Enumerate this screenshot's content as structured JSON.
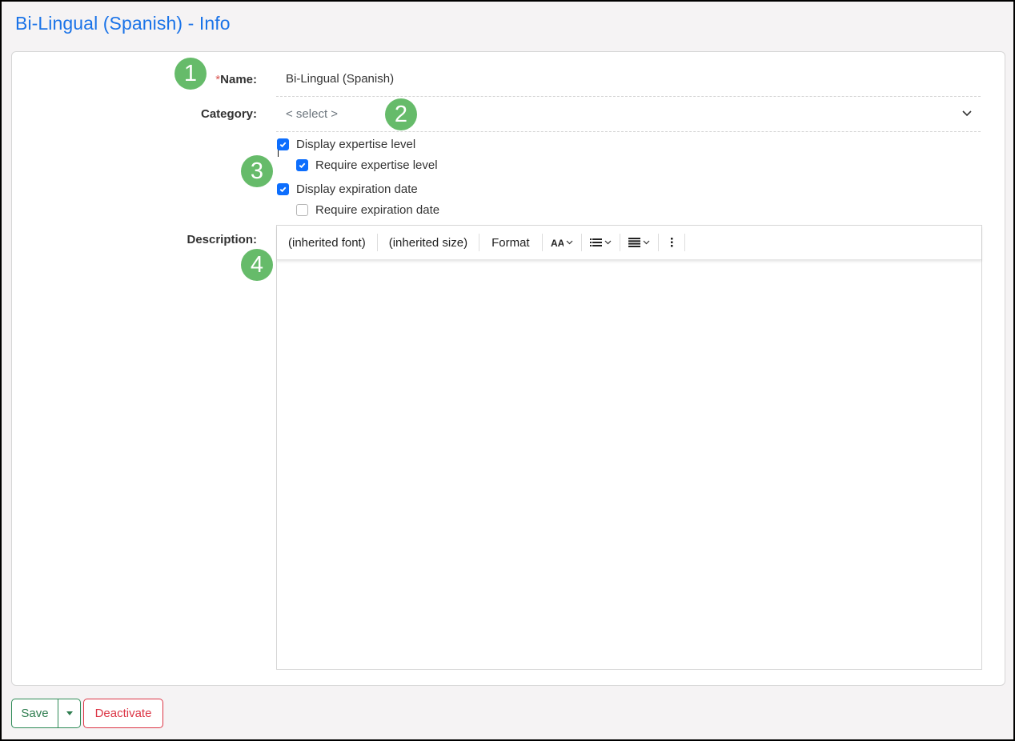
{
  "page": {
    "title": "Bi-Lingual (Spanish) - Info"
  },
  "form": {
    "name": {
      "required_marker": "*",
      "label": "Name:",
      "value": "Bi-Lingual (Spanish)"
    },
    "category": {
      "label": "Category:",
      "placeholder": "< select >"
    },
    "checkboxes": [
      {
        "label": "Display expertise level",
        "checked": true
      },
      {
        "label": "Require expertise level",
        "checked": true
      },
      {
        "label": "Display expiration date",
        "checked": true
      },
      {
        "label": "Require expiration date",
        "checked": false
      }
    ],
    "description": {
      "label": "Description:",
      "toolbar": {
        "font": "(inherited font)",
        "size": "(inherited size)",
        "format": "Format",
        "icons": [
          "text-size-icon",
          "list-icon",
          "align-icon",
          "more-vertical-icon"
        ]
      },
      "value": ""
    }
  },
  "callouts": [
    "1",
    "2",
    "3",
    "4"
  ],
  "actions": {
    "save_label": "Save",
    "deactivate_label": "Deactivate"
  },
  "colors": {
    "title": "#1a73e8",
    "checkbox": "#0d6efd",
    "save": "#2e8b57",
    "deactivate": "#dc3545",
    "callout": "#66bb6a"
  }
}
